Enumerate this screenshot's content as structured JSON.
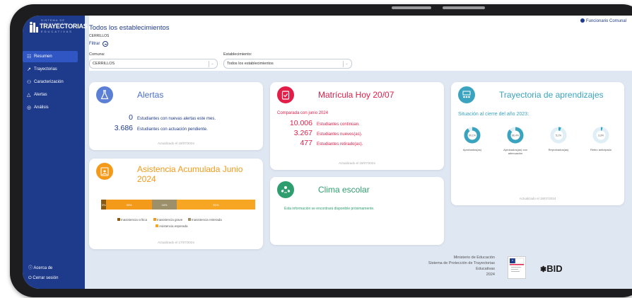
{
  "colors": {
    "primary": "#1e3a8a",
    "alertas": "#5b7fd4",
    "matricula": "#e11d48",
    "clima": "#2f9e6e",
    "trayectoria": "#3aa3c0",
    "asistencia": "#f39a1b"
  },
  "sidebar": {
    "logo": {
      "sup": "SISTEMA DE PROTECCIÓN",
      "main": "TRAYECTORIAS",
      "sub": "EDUCATIVAS",
      "icon": "logo-figures-icon"
    },
    "items": [
      {
        "label": "Resumen",
        "icon": "grid-icon",
        "glyph": "☷",
        "active": true
      },
      {
        "label": "Trayectorias",
        "icon": "route-icon",
        "glyph": "↗",
        "active": false
      },
      {
        "label": "Caracterización",
        "icon": "people-icon",
        "glyph": "⚇",
        "active": false
      },
      {
        "label": "Alertas",
        "icon": "warning-icon",
        "glyph": "△",
        "active": false
      },
      {
        "label": "Análisis",
        "icon": "analysis-icon",
        "glyph": "◎",
        "active": false
      }
    ],
    "bottom": [
      {
        "label": "Acerca de",
        "glyph": "ⓘ"
      },
      {
        "label": "Cerrar sesión",
        "glyph": "⏻"
      }
    ]
  },
  "header": {
    "user": "Funcionario Comunal",
    "title": "Todos los establecimientos",
    "subtitle": "CERRILLOS",
    "filter_label": "Filtrar",
    "comuna_label": "Comuna:",
    "comuna_value": "CERRILLOS",
    "establecimiento_label": "Establecimiento:",
    "establecimiento_value": "Todos los establecimientos"
  },
  "alertas": {
    "title": "Alertas",
    "icon": "flask-icon",
    "rows": [
      {
        "num": "0",
        "text": "Estudiantes con nuevas alertas este mes."
      },
      {
        "num": "3.686",
        "text": "Estudiantes con actuación pendiente."
      }
    ],
    "updated": "Actualizado el 18/07/2024"
  },
  "matricula": {
    "title": "Matrícula Hoy 20/07",
    "icon": "clipboard-icon",
    "compare": "Comparada con junio 2024",
    "rows": [
      {
        "num": "10.006",
        "text": "Estudiantes continúan."
      },
      {
        "num": "3.267",
        "text": "Estudiantes nuevos(as)."
      },
      {
        "num": "477",
        "text": "Estudiantes retirado(as)."
      }
    ],
    "updated": "Actualizado el 18/07/2024"
  },
  "trayectoria": {
    "title": "Trayectoria de aprendizajes",
    "icon": "classroom-icon",
    "subtitle": "Situación al cierre del año 2023:",
    "donuts": [
      {
        "label": "Aprobados(as)",
        "value": "90,1%"
      },
      {
        "label": "Aprobados(as) con adecuación",
        "value": "86,4%"
      },
      {
        "label": "Reprobados(as)",
        "value": "5,1%"
      },
      {
        "label": "Retiro anticipado",
        "value": "3,3%"
      }
    ],
    "updated": "Actualizado el 18/07/2024"
  },
  "asistencia": {
    "title_l1": "Asistencia Acumulada Junio",
    "title_l2": "2024",
    "icon": "calendar-person-icon",
    "segments": [
      {
        "label": "3%",
        "value": 3,
        "color": "#8a5a12"
      },
      {
        "label": "30%",
        "value": 30,
        "color": "#f39a1b"
      },
      {
        "label": "16%",
        "value": 16,
        "color": "#9b9069"
      },
      {
        "label": "51%",
        "value": 51,
        "color": "#f6a623"
      }
    ],
    "legend": [
      {
        "label": "Inasistencia crítica",
        "color": "#8a5a12"
      },
      {
        "label": "Inasistencia grave",
        "color": "#f39a1b"
      },
      {
        "label": "Inasistencia reiterada",
        "color": "#9b9069"
      },
      {
        "label": "Asistencia esperada",
        "color": "#f6a623"
      }
    ],
    "updated": "Actualizado el 17/07/2024"
  },
  "clima": {
    "title": "Clima escolar",
    "icon": "people-group-icon",
    "text": "Esta información se encontrará disponible próximamente."
  },
  "footer": {
    "lines": [
      "Ministerio de Educación",
      "Sistema de Protección de Trayectorias",
      "Educativas",
      "2024"
    ],
    "bid": "BID",
    "shield_icon": "gobierno-shield-icon"
  }
}
